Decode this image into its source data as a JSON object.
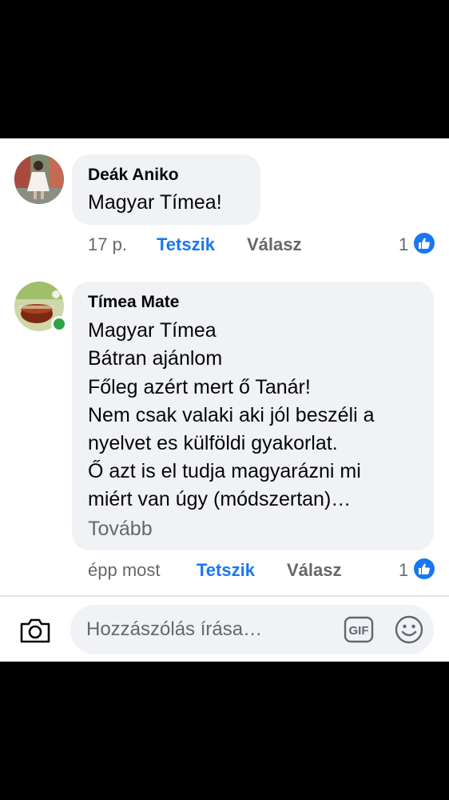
{
  "comments": [
    {
      "author": "Deák Aniko",
      "lines": [
        "Magyar Tímea!"
      ],
      "time": "17 p.",
      "like_label": "Tetszik",
      "reply_label": "Válasz",
      "reaction_count": "1"
    },
    {
      "author": "Tímea Mate",
      "lines": [
        "Magyar Tímea",
        "Bátran ajánlom",
        "Főleg azért mert ő Tanár!",
        "Nem csak valaki aki jól beszéli a",
        "nyelvet es külföldi gyakorlat.",
        "Ő azt is el tudja magyarázni mi",
        "miért van úgy (módszertan)…"
      ],
      "more_label": "Tovább",
      "time": "épp most",
      "like_label": "Tetszik",
      "reply_label": "Válasz",
      "reaction_count": "1",
      "online": true
    }
  ],
  "composer": {
    "placeholder": "Hozzászólás írása…",
    "camera_icon": "camera-icon",
    "gif_icon": "gif-icon",
    "emoji_icon": "emoji-icon"
  },
  "colors": {
    "accent": "#1877f2",
    "bubble": "#f0f2f5",
    "secondary_text": "#65676b",
    "online": "#31a24c"
  }
}
